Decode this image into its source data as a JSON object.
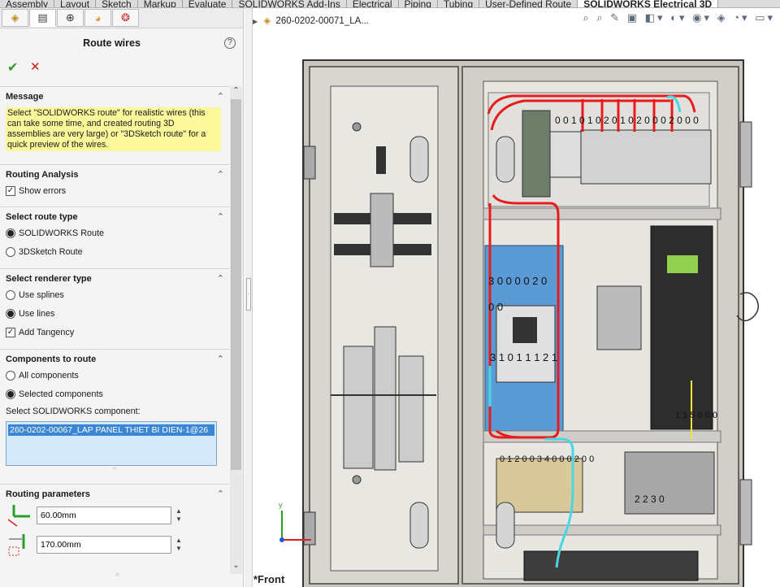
{
  "ribbon_tabs": [
    "Assembly",
    "Layout",
    "Sketch",
    "Markup",
    "Evaluate",
    "SOLIDWORKS Add-Ins",
    "Electrical",
    "Piping",
    "Tubing",
    "User-Defined Route",
    "SOLIDWORKS Electrical 3D"
  ],
  "active_tab_index": 10,
  "panel": {
    "title": "Route wires",
    "help": "?",
    "ok": "✔",
    "cancel": "✕",
    "message": {
      "header": "Message",
      "text": "Select \"SOLIDWORKS route\" for realistic wires (this can take some time, and created routing 3D assemblies are very large) or \"3DSketch route\" for a quick preview of the wires."
    },
    "routing_analysis": {
      "header": "Routing Analysis",
      "show_errors": "Show errors",
      "show_errors_checked": true
    },
    "route_type": {
      "header": "Select route type",
      "opt1": "SOLIDWORKS Route",
      "opt2": "3DSketch Route",
      "selected": 1
    },
    "renderer": {
      "header": "Select renderer type",
      "opt1": "Use splines",
      "opt2": "Use lines",
      "selected": 2,
      "tangency": "Add Tangency",
      "tangency_checked": true
    },
    "components": {
      "header": "Components to route",
      "opt1": "All components",
      "opt2": "Selected components",
      "selected": 2,
      "select_label": "Select SOLIDWORKS component:",
      "selected_item": "260-0202-00067_LAP PANEL THIET BI DIEN-1@26"
    },
    "routing_params": {
      "header": "Routing parameters",
      "value1": "60.00mm",
      "value2": "170.00mm"
    }
  },
  "graphics": {
    "tree_item": "260-0202-00071_LA...",
    "view_label": "*Front",
    "terminal_labels": {
      "top_row": "0 0 1 0 1 0 2 0 1 0 2 0 0 0 2 0 0 0",
      "breaker_top": "3 0 0 0 0 2 0",
      "breaker_bottom": "3 1 0 1 1 1 2 1",
      "breaker_side": "0 0",
      "io_row": "0 1 2 0 0 3 4 0 0 0 2 0 0",
      "plc_bottom": "2 2 3 0",
      "plc_label": "1 1 5 0 0 0"
    }
  },
  "colors": {
    "wire": "#e81b1b",
    "wire_alt": "#4ad6e0",
    "breaker": "#5b9bd5",
    "panel_bg": "#f4f4f4",
    "message_bg": "#fbf79b",
    "select_bg": "#d6e9fb"
  }
}
